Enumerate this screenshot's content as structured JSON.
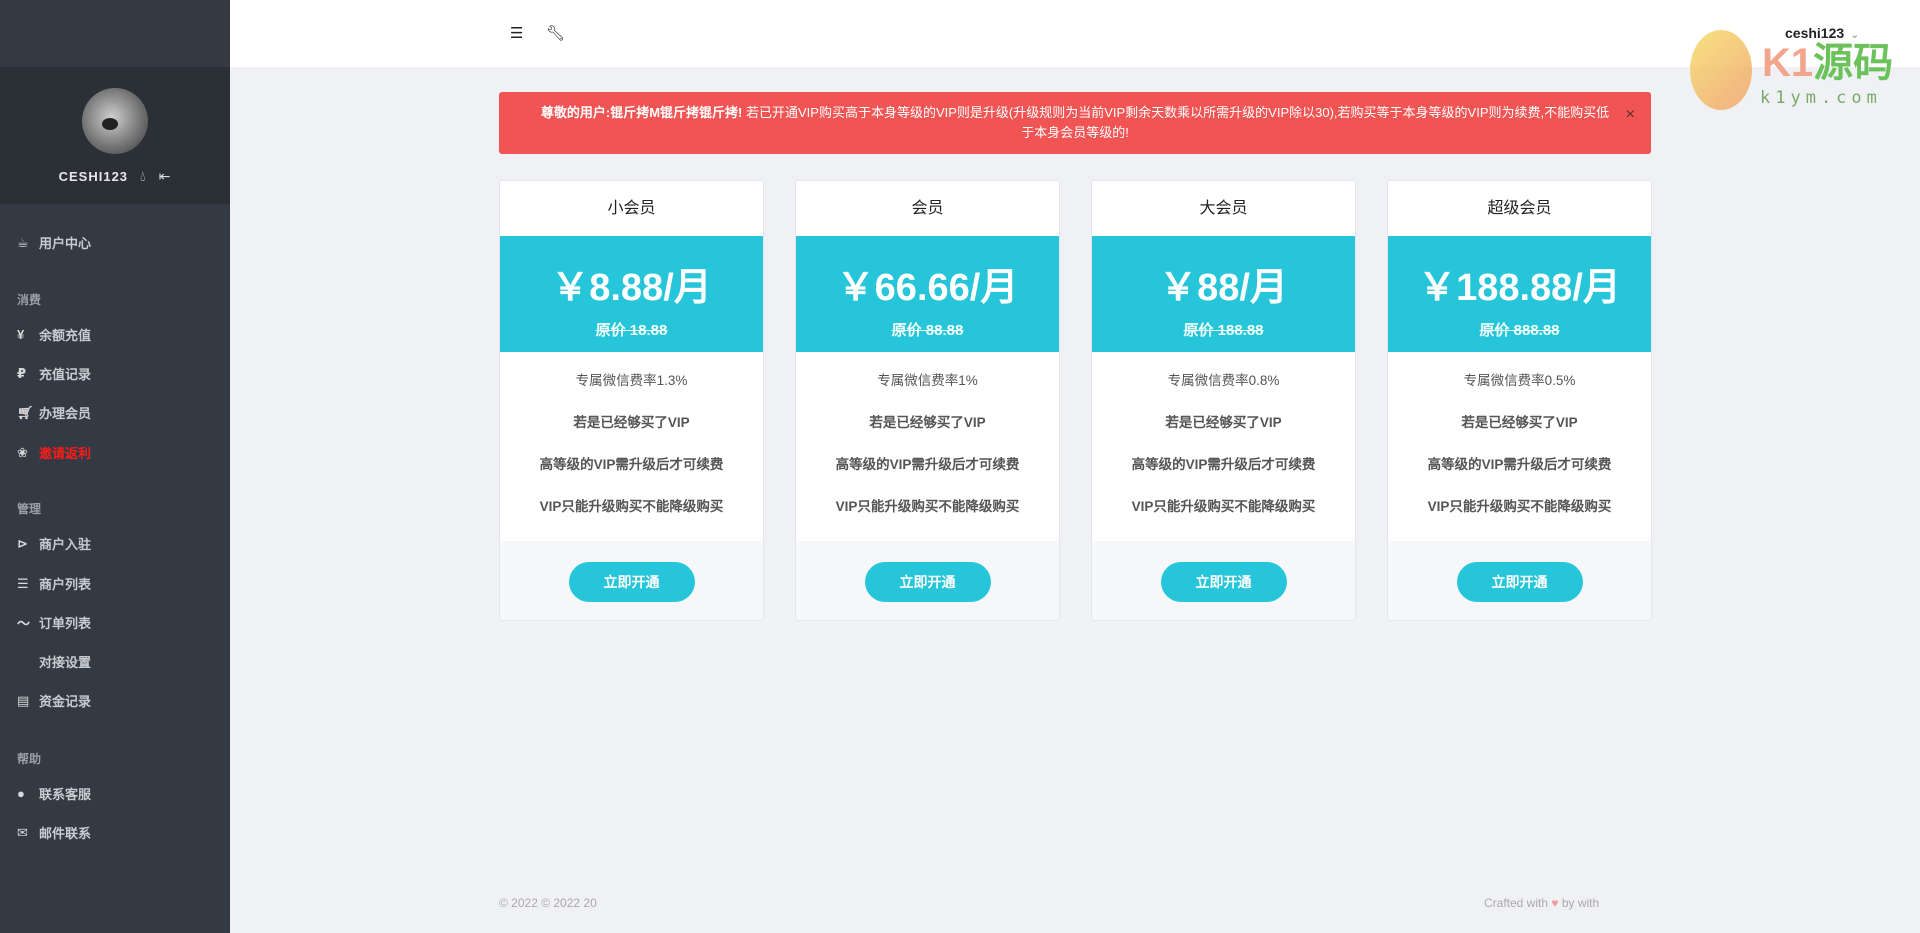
{
  "sidebar": {
    "username": "CESHI123",
    "items": [
      {
        "label": "用户中心",
        "icon": "coffee-icon"
      },
      {
        "section": "消费"
      },
      {
        "label": "余额充值",
        "icon": "yen-icon"
      },
      {
        "label": "充值记录",
        "icon": "ruble-icon"
      },
      {
        "label": "办理会员",
        "icon": "cart-icon"
      },
      {
        "label": "邀请返利",
        "icon": "award-icon",
        "highlight": "#ff1a1a"
      },
      {
        "section": "管理"
      },
      {
        "label": "商户入驻",
        "icon": "forward-icon"
      },
      {
        "label": "商户列表",
        "icon": "list-icon"
      },
      {
        "label": "订单列表",
        "icon": "trend-icon"
      },
      {
        "label": "对接设置",
        "icon": "code-icon"
      },
      {
        "label": "资金记录",
        "icon": "table-icon"
      },
      {
        "section": "帮助"
      },
      {
        "label": "联系客服",
        "icon": "qq-icon"
      },
      {
        "label": "邮件联系",
        "icon": "mail-icon"
      }
    ]
  },
  "header": {
    "user": "ceshi123"
  },
  "alert": {
    "bold": "尊敬的用户:锟斤拷M锟斤拷锟斤拷!",
    "text": " 若已开通VIP购买高于本身等级的VIP则是升级(升级规则为当前VIP剩余天数乘以所需升级的VIP除以30),若购买等于本身等级的VIP则为续费,不能购买低于本身会员等级的!",
    "close": "×"
  },
  "plans": [
    {
      "name": "小会员",
      "price": "￥8.88/月",
      "original": "原价 18.88",
      "rate": "专属微信费率1.3%",
      "f1": "若是已经够买了VIP",
      "f2": "高等级的VIP需升级后才可续费",
      "f3": "VIP只能升级购买不能降级购买",
      "button": "立即开通"
    },
    {
      "name": "会员",
      "price": "￥66.66/月",
      "original": "原价 88.88",
      "rate": "专属微信费率1%",
      "f1": "若是已经够买了VIP",
      "f2": "高等级的VIP需升级后才可续费",
      "f3": "VIP只能升级购买不能降级购买",
      "button": "立即开通"
    },
    {
      "name": "大会员",
      "price": "￥88/月",
      "original": "原价 188.88",
      "rate": "专属微信费率0.8%",
      "f1": "若是已经够买了VIP",
      "f2": "高等级的VIP需升级后才可续费",
      "f3": "VIP只能升级购买不能降级购买",
      "button": "立即开通"
    },
    {
      "name": "超级会员",
      "price": "￥188.88/月",
      "original": "原价 888.88",
      "rate": "专属微信费率0.5%",
      "f1": "若是已经够买了VIP",
      "f2": "高等级的VIP需升级后才可续费",
      "f3": "VIP只能升级购买不能降级购买",
      "button": "立即开通"
    }
  ],
  "footer": {
    "left": "© 2022  © 2022 20",
    "right_a": "Crafted with",
    "right_b": "by with"
  },
  "watermark": {
    "brand": "K1",
    "brand_b": "源码",
    "url": "k1ym.com"
  },
  "colors": {
    "accent": "#26c5d9",
    "alert": "#f05453"
  }
}
